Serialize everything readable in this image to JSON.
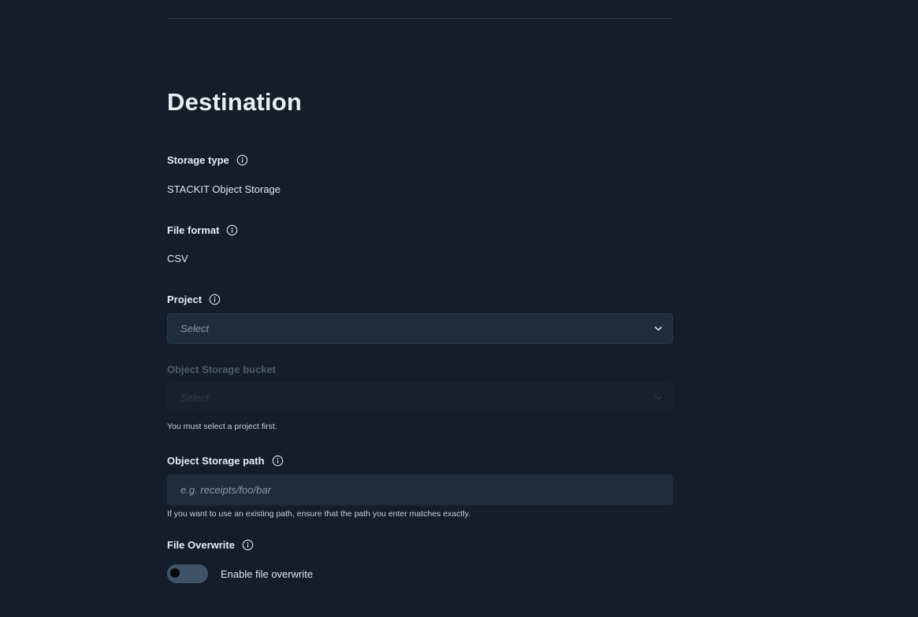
{
  "section": {
    "title": "Destination"
  },
  "storage_type": {
    "label": "Storage type",
    "value": "STACKIT Object Storage"
  },
  "file_format": {
    "label": "File format",
    "value": "CSV"
  },
  "project": {
    "label": "Project",
    "placeholder": "Select"
  },
  "bucket": {
    "label": "Object Storage bucket",
    "placeholder": "Select",
    "helper": "You must select a project first."
  },
  "path": {
    "label": "Object Storage path",
    "placeholder": "e.g. receipts/foo/bar",
    "value": "",
    "helper": "If you want to use an existing path, ensure that the path you enter matches exactly."
  },
  "overwrite": {
    "label": "File Overwrite",
    "toggle_label": "Enable file overwrite",
    "enabled": false
  },
  "icons": {
    "info": "info-icon",
    "chevron": "chevron-down-icon"
  },
  "colors": {
    "background": "#131e2a",
    "input_background": "#1f2d3b",
    "toggle_track": "#3e5466"
  }
}
